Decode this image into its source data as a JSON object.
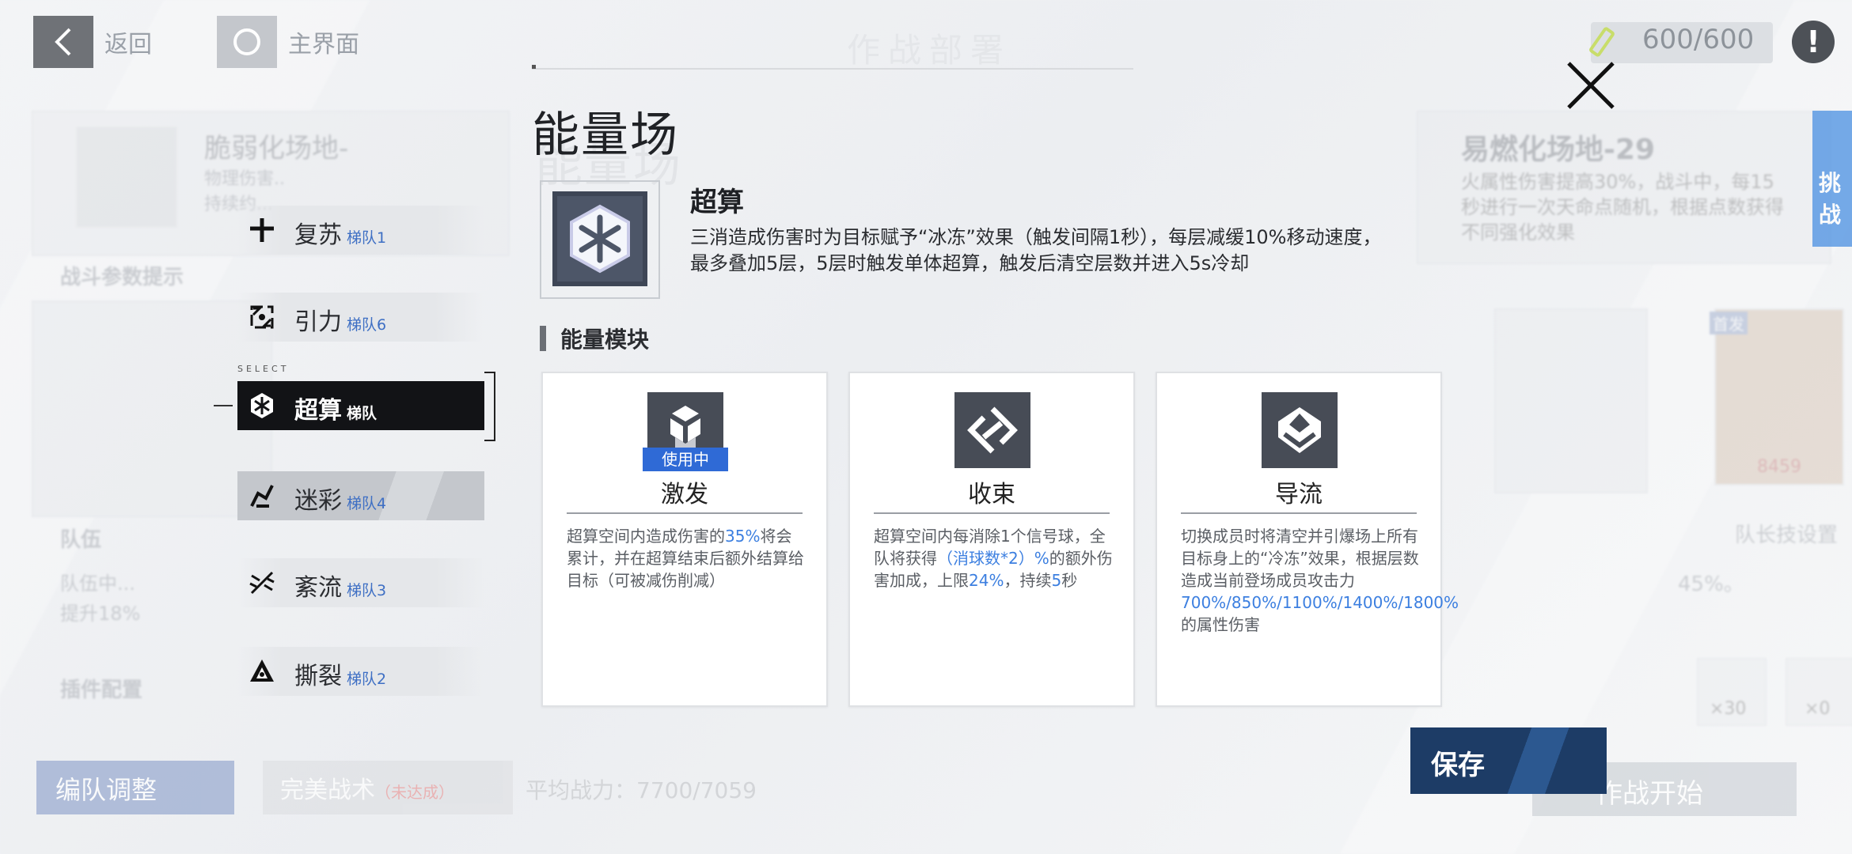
{
  "top_bar": {
    "back_label": "返回",
    "home_label": "主界面",
    "page_title": "作战部署",
    "energy": "600/600",
    "info_glyph": "!"
  },
  "background": {
    "left_card_title": "脆弱化场地-",
    "left_card_lines": [
      "物理伤害..",
      "持续约..."
    ],
    "battle_params": "战斗参数提示",
    "team_label": "队伍",
    "team_lines": [
      "队伍中...",
      "提升18%"
    ],
    "plugin_label": "插件配置",
    "right_card_title": "易燃化场地-29",
    "right_card_lines": [
      "火属性伤害提高30%，战斗中，每15",
      "秒进行一次天命点随机，根据点数获得",
      "不同强化效果"
    ],
    "challenge_tab": "挑战",
    "card_tag": "首发",
    "card_number": "8459",
    "leader_skill": "队长技设置",
    "percent_text": "45%。",
    "item_counts": [
      "×30",
      "×0"
    ],
    "formation_button": "编队调整",
    "perfect_tactic": "完美战术",
    "perfect_tactic_note": "（未达成）",
    "avg_power": "平均战力：7700/7059",
    "start_button": "作战开始"
  },
  "modal": {
    "title": "能量场",
    "close_icon": "close-x-icon",
    "field": {
      "name": "超算",
      "desc_line1": "三消造成伤害时为目标赋予“冰冻”效果（触发间隔1秒），每层减缓10%移动速度，",
      "desc_line2": "最多叠加5层，5层时触发单体超算，触发后清空层数并进入5s冷却",
      "icon": "hex-snowflake-icon"
    },
    "section_label": "能量模块",
    "modules": [
      {
        "name": "激发",
        "badge": "使用中",
        "icon": "cubes-icon",
        "desc_a": "超算空间内造成伤害的",
        "desc_hl": "35%",
        "desc_b": "将会累计，并在超算结束后额外结算给目标（可被减伤削减）"
      },
      {
        "name": "收束",
        "icon": "converge-diamond-icon",
        "desc_a": "超算空间内每消除1个信号球，全队将获得",
        "desc_hl": "（消球数*2）%",
        "desc_b": "的额外伤害加成，上限",
        "desc_hl2": "24%",
        "desc_c": "，持续",
        "desc_hl3": "5",
        "desc_d": "秒"
      },
      {
        "name": "导流",
        "icon": "flow-down-icon",
        "desc_a": "切换成员时将清空并引爆场上所有目标身上的“冷冻”效果，根据层数造成当前登场成员攻击力",
        "desc_hl": "700%/850%/1100%/1400%/1800%",
        "desc_b": "的属性伤害"
      }
    ],
    "save_label": "保存"
  },
  "squads": {
    "select_caption": "SELECT",
    "items": [
      {
        "name": "复苏",
        "tag": "梯队1",
        "icon": "plus-icon"
      },
      {
        "name": "引力",
        "tag": "梯队6",
        "icon": "gravity-icon"
      },
      {
        "name": "超算",
        "tag": "梯队",
        "icon": "hex-snowflake-icon"
      },
      {
        "name": "迷彩",
        "tag": "梯队4",
        "icon": "camo-icon"
      },
      {
        "name": "紊流",
        "tag": "梯队3",
        "icon": "turbulence-icon"
      },
      {
        "name": "撕裂",
        "tag": "梯队2",
        "icon": "tear-icon"
      }
    ]
  }
}
